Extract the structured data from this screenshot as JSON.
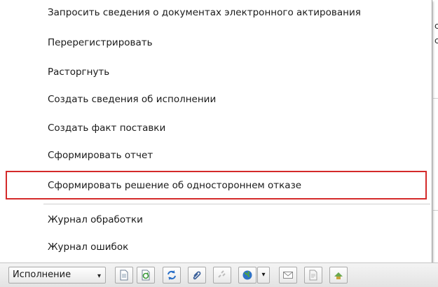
{
  "menu": {
    "items": [
      {
        "label": "Запросить сведения о документах электронного актирования"
      },
      {
        "label": "Перерегистрировать"
      },
      {
        "label": "Расторгнуть"
      },
      {
        "label": "Создать сведения об исполнении"
      },
      {
        "label": "Создать факт поставки"
      },
      {
        "label": "Сформировать отчет"
      },
      {
        "label": "Сформировать решение об одностороннем отказе"
      },
      {
        "label": "Журнал обработки"
      },
      {
        "label": "Журнал ошибок"
      }
    ]
  },
  "toolbar": {
    "dropdown_label": "Исполнение",
    "caret": "▾",
    "icons": [
      "document-icon",
      "document-refresh-icon",
      "refresh-icon",
      "paperclip-icon",
      "link-icon",
      "globe-icon",
      "email-icon",
      "page-icon",
      "export-icon"
    ]
  },
  "background": {
    "right_fragments": [
      "с",
      "с"
    ]
  },
  "colors": {
    "highlight": "#d42a2a",
    "toolbar_bg": "#e9e9e9"
  }
}
